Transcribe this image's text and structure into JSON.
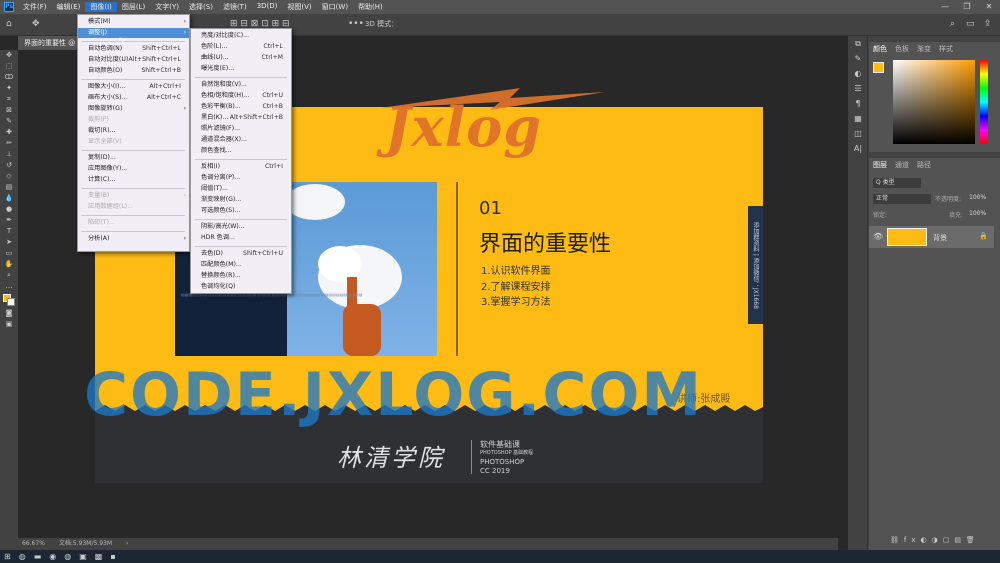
{
  "menubar": {
    "logo": "Ps",
    "items": [
      "文件(F)",
      "编辑(E)",
      "图像(I)",
      "图层(L)",
      "文字(Y)",
      "选择(S)",
      "滤镜(T)",
      "3D(D)",
      "视图(V)",
      "窗口(W)",
      "帮助(H)"
    ],
    "active_index": 2,
    "window_buttons": [
      "—",
      "❐",
      "✕"
    ]
  },
  "optionsbar": {
    "mode_3d": "3D 模式："
  },
  "tab": {
    "title": "界面的重要性 @"
  },
  "status": {
    "zoom": "66.67%",
    "doc": "文档:5.93M/5.93M"
  },
  "image_menu": {
    "items": [
      {
        "label": "模式(M)",
        "arrow": "›",
        "shortcut": ""
      },
      {
        "label": "调整(J)",
        "arrow": "›",
        "shortcut": "",
        "highlight": true
      },
      {
        "sep": true
      },
      {
        "label": "自动色调(N)",
        "shortcut": "Shift+Ctrl+L"
      },
      {
        "label": "自动对比度(U)",
        "shortcut": "Alt+Shift+Ctrl+L"
      },
      {
        "label": "自动颜色(O)",
        "shortcut": "Shift+Ctrl+B"
      },
      {
        "sep": true
      },
      {
        "label": "图像大小(I)...",
        "shortcut": "Alt+Ctrl+I"
      },
      {
        "label": "画布大小(S)...",
        "shortcut": "Alt+Ctrl+C"
      },
      {
        "label": "图像旋转(G)",
        "arrow": "›",
        "shortcut": ""
      },
      {
        "label": "裁剪(P)",
        "shortcut": "",
        "disabled": true
      },
      {
        "label": "裁切(R)...",
        "shortcut": ""
      },
      {
        "label": "显示全部(V)",
        "shortcut": "",
        "disabled": true
      },
      {
        "sep": true
      },
      {
        "label": "复制(D)...",
        "shortcut": ""
      },
      {
        "label": "应用图像(Y)...",
        "shortcut": ""
      },
      {
        "label": "计算(C)...",
        "shortcut": ""
      },
      {
        "sep": true
      },
      {
        "label": "变量(B)",
        "arrow": "›",
        "shortcut": "",
        "disabled": true
      },
      {
        "label": "应用数据组(L)...",
        "shortcut": "",
        "disabled": true
      },
      {
        "sep": true
      },
      {
        "label": "陷印(T)...",
        "shortcut": "",
        "disabled": true
      },
      {
        "sep": true
      },
      {
        "label": "分析(A)",
        "arrow": "›",
        "shortcut": ""
      }
    ]
  },
  "adjust_menu": {
    "items": [
      {
        "label": "亮度/对比度(C)...",
        "shortcut": ""
      },
      {
        "label": "色阶(L)...",
        "shortcut": "Ctrl+L"
      },
      {
        "label": "曲线(U)...",
        "shortcut": "Ctrl+M"
      },
      {
        "label": "曝光度(E)...",
        "shortcut": ""
      },
      {
        "sep": true
      },
      {
        "label": "自然饱和度(V)...",
        "shortcut": ""
      },
      {
        "label": "色相/饱和度(H)...",
        "shortcut": "Ctrl+U"
      },
      {
        "label": "色彩平衡(B)...",
        "shortcut": "Ctrl+B"
      },
      {
        "label": "黑白(K)...",
        "shortcut": "Alt+Shift+Ctrl+B"
      },
      {
        "label": "照片滤镜(F)...",
        "shortcut": ""
      },
      {
        "label": "通道混合器(X)...",
        "shortcut": ""
      },
      {
        "label": "颜色查找...",
        "shortcut": ""
      },
      {
        "sep": true
      },
      {
        "label": "反相(I)",
        "shortcut": "Ctrl+I"
      },
      {
        "label": "色调分离(P)...",
        "shortcut": ""
      },
      {
        "label": "阈值(T)...",
        "shortcut": ""
      },
      {
        "label": "渐变映射(G)...",
        "shortcut": ""
      },
      {
        "label": "可选颜色(S)...",
        "shortcut": ""
      },
      {
        "sep": true
      },
      {
        "label": "阴影/高光(W)...",
        "shortcut": ""
      },
      {
        "label": "HDR 色调...",
        "shortcut": ""
      },
      {
        "sep": true
      },
      {
        "label": "去色(D)",
        "shortcut": "Shift+Ctrl+U"
      },
      {
        "label": "匹配颜色(M)...",
        "shortcut": ""
      },
      {
        "label": "替换颜色(R)...",
        "shortcut": ""
      },
      {
        "label": "色调均化(Q)",
        "shortcut": ""
      }
    ]
  },
  "slide": {
    "logo": "Jxlog",
    "number": "01",
    "heading": "界面的重要性",
    "bullets": [
      "1.认识软件界面",
      "2.了解课程安排",
      "3.掌握学习方法"
    ],
    "lecturer": "讲师:张成殿",
    "side_tag": "添加群资料 | 添加微信：JX1668",
    "school": "林清学院",
    "course_line1": "软件基础课",
    "course_line2": "PHOTOSHOP 基础教程",
    "course_line3": "PHOTOSHOP",
    "course_line4": "CC 2019"
  },
  "watermark": "CODE.JXLOG.COM",
  "right_panel": {
    "color_tabs": [
      "颜色",
      "色板",
      "渐变",
      "样式"
    ],
    "layer_tabs": [
      "图层",
      "通道",
      "路径"
    ],
    "kind": "Q 类型",
    "blend": "正常",
    "opacity_label": "不透明度:",
    "opacity": "100%",
    "lock_label": "锁定:",
    "fill_label": "填充:",
    "fill": "100%",
    "layer_name": "背景"
  },
  "colors": {
    "accent": "#fdbb14",
    "orange": "#e2742a",
    "watermark": "#1e78c8"
  }
}
